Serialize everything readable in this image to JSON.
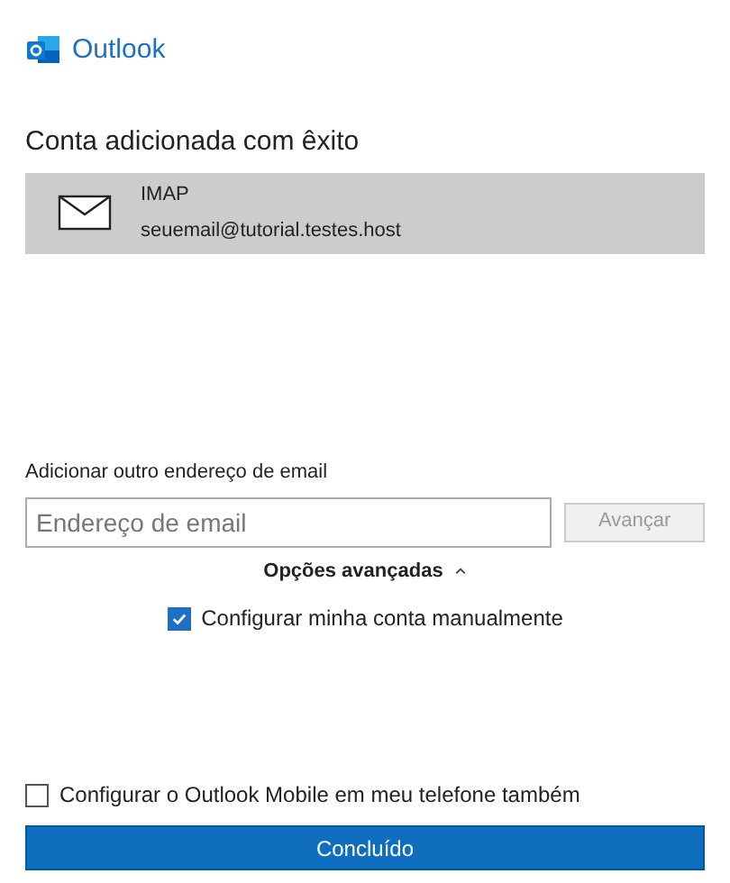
{
  "app": {
    "name": "Outlook"
  },
  "heading": "Conta adicionada com êxito",
  "account": {
    "type": "IMAP",
    "email": "seuemail@tutorial.testes.host",
    "selected": true
  },
  "add_account": {
    "label": "Adicionar outro endereço de email",
    "placeholder": "Endereço de email",
    "button": {
      "label": "Avançar",
      "disabled": true
    }
  },
  "advanced": {
    "label": "Opções avançadas",
    "expanded": true,
    "options": [
      {
        "label": "Configurar minha conta manualmente",
        "checked": true
      }
    ]
  },
  "mobile": {
    "label": "Configurar o Outlook Mobile em meu telefone também",
    "checked": false
  },
  "done_button": "Concluído"
}
